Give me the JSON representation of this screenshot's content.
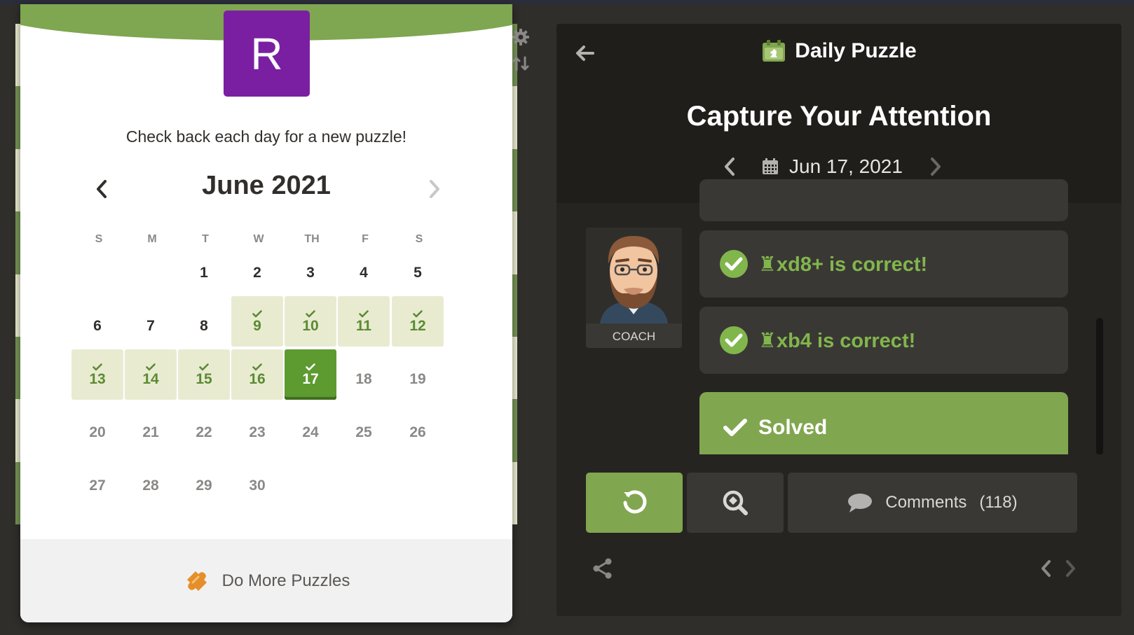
{
  "modal": {
    "avatar_letter": "R",
    "subtitle": "Check back each day for a new puzzle!",
    "month_title": "June 2021",
    "weekdays": [
      "S",
      "M",
      "T",
      "W",
      "TH",
      "F",
      "S"
    ],
    "days": [
      {
        "d": "1",
        "state": "past"
      },
      {
        "d": "2",
        "state": "past"
      },
      {
        "d": "3",
        "state": "past"
      },
      {
        "d": "4",
        "state": "past"
      },
      {
        "d": "5",
        "state": "past"
      },
      {
        "d": "6",
        "state": "past"
      },
      {
        "d": "7",
        "state": "past"
      },
      {
        "d": "8",
        "state": "past"
      },
      {
        "d": "9",
        "state": "solved"
      },
      {
        "d": "10",
        "state": "solved"
      },
      {
        "d": "11",
        "state": "solved"
      },
      {
        "d": "12",
        "state": "solved"
      },
      {
        "d": "13",
        "state": "solved"
      },
      {
        "d": "14",
        "state": "solved"
      },
      {
        "d": "15",
        "state": "solved"
      },
      {
        "d": "16",
        "state": "solved"
      },
      {
        "d": "17",
        "state": "current"
      },
      {
        "d": "18",
        "state": "future"
      },
      {
        "d": "19",
        "state": "future"
      },
      {
        "d": "20",
        "state": "future"
      },
      {
        "d": "21",
        "state": "future"
      },
      {
        "d": "22",
        "state": "future"
      },
      {
        "d": "23",
        "state": "future"
      },
      {
        "d": "24",
        "state": "future"
      },
      {
        "d": "25",
        "state": "future"
      },
      {
        "d": "26",
        "state": "future"
      },
      {
        "d": "27",
        "state": "future"
      },
      {
        "d": "28",
        "state": "future"
      },
      {
        "d": "29",
        "state": "future"
      },
      {
        "d": "30",
        "state": "future"
      }
    ],
    "footer_label": "Do More Puzzles"
  },
  "panel": {
    "header_title": "Daily Puzzle",
    "puzzle_name": "Capture Your Attention",
    "date": "Jun 17, 2021",
    "coach_label": "COACH",
    "moves": [
      {
        "text": "♜xd8+ is correct!"
      },
      {
        "text": "♜xb4 is correct!"
      }
    ],
    "solved_label": "Solved",
    "comments_label": "Comments",
    "comments_count": "(118)"
  },
  "colors": {
    "accent_green": "#81a650",
    "current_day": "#5d9b30",
    "avatar_bg": "#7b1fa2",
    "move_text": "#81b64c"
  },
  "icons": {
    "settings": "gear-icon",
    "flip": "flip-board-icon",
    "back": "arrow-left-icon",
    "header": "daily-puzzle-icon",
    "calendar": "calendar-icon",
    "retry": "retry-icon",
    "analyze": "magnifier-icon",
    "comments": "speech-bubble-icon",
    "share": "share-icon",
    "footer": "puzzle-piece-icon"
  }
}
